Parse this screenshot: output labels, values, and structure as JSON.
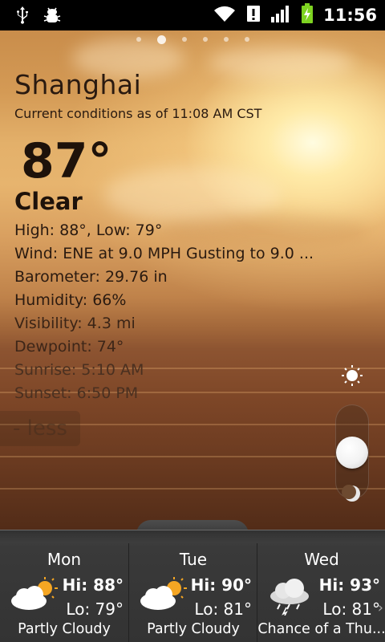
{
  "status_bar": {
    "time": "11:56",
    "icons": [
      "usb-icon",
      "debug-bug-icon",
      "wifi-icon",
      "alert-icon",
      "signal-icon",
      "battery-charging-icon"
    ]
  },
  "weather": {
    "city": "Shanghai",
    "as_of": "Current conditions as of  11:08 AM CST",
    "temperature": "87°",
    "condition": "Clear",
    "details": [
      "High: 88°, Low: 79°",
      "Wind: ENE at 9.0 MPH Gusting to 9.0 ...",
      "Barometer: 29.76 in",
      "Humidity: 66%",
      "Visibility: 4.3 mi",
      "Dewpoint: 74°",
      "Sunrise: 5:10 AM",
      "Sunset: 6:50 PM"
    ],
    "less_label": "- less"
  },
  "day_night_slider": {
    "icons": [
      "sun-icon",
      "moon-icon"
    ]
  },
  "forecast": [
    {
      "day": "Mon",
      "hi": "Hi: 88°",
      "lo": "Lo: 79°",
      "condition": "Partly Cloudy",
      "icon": "partly-cloudy-icon"
    },
    {
      "day": "Tue",
      "hi": "Hi: 90°",
      "lo": "Lo: 81°",
      "condition": "Partly Cloudy",
      "icon": "partly-cloudy-icon"
    },
    {
      "day": "Wed",
      "hi": "Hi: 93°",
      "lo": "Lo: 81°",
      "condition": "Chance of a Thu...",
      "icon": "thunderstorm-icon"
    }
  ]
}
